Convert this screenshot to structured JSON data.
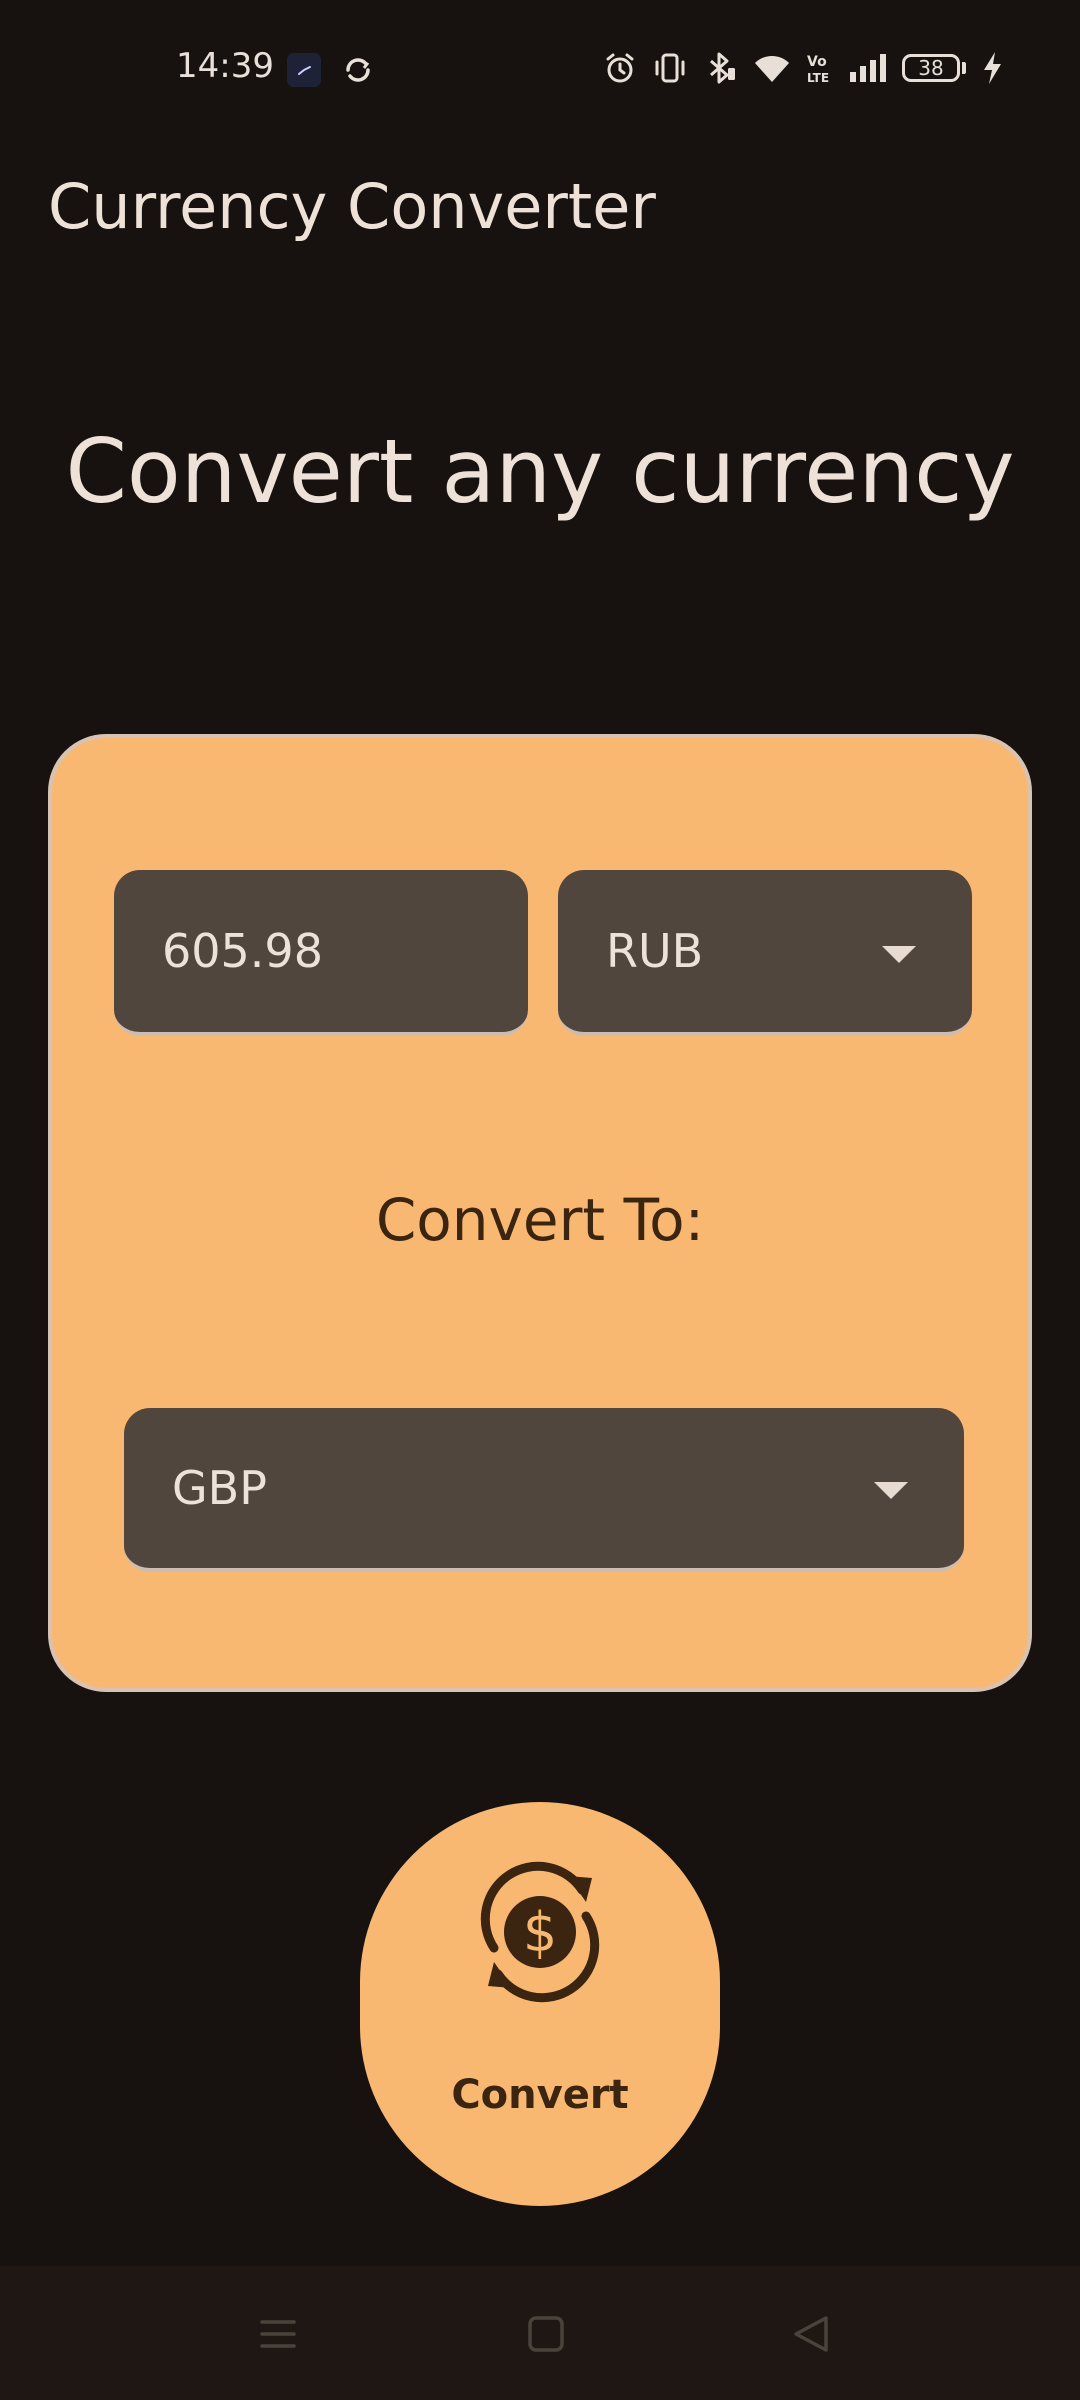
{
  "status_bar": {
    "time": "14:39",
    "battery_level": "38",
    "icons": [
      "clock-app-icon",
      "sync-icon",
      "alarm-icon",
      "vibrate-icon",
      "bluetooth-icon",
      "wifi-icon",
      "volte-icon",
      "signal-icon",
      "battery-icon",
      "charging-icon"
    ]
  },
  "app": {
    "title": "Currency Converter"
  },
  "main": {
    "headline": "Convert any currency",
    "amount_value": "605.98",
    "from_currency": "RUB",
    "convert_to_label": "Convert To:",
    "to_currency": "GBP",
    "convert_button_label": "Convert"
  },
  "colors": {
    "background": "#17120f",
    "card": "#f9b872",
    "field": "#51463d",
    "accent_text": "#3b2410"
  },
  "nav_bar": {
    "icons": [
      "menu-icon",
      "home-icon",
      "back-icon"
    ]
  }
}
